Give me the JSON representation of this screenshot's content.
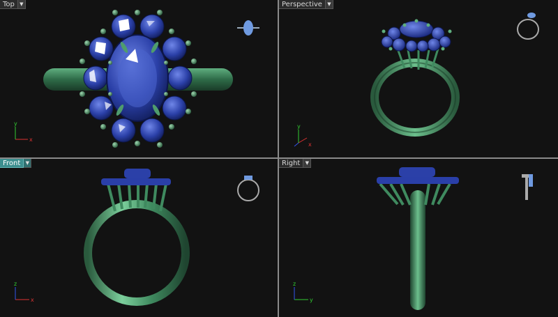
{
  "viewports": {
    "top": {
      "title": "Top"
    },
    "perspective": {
      "title": "Perspective"
    },
    "front": {
      "title": "Front"
    },
    "right": {
      "title": "Right"
    }
  },
  "axes": {
    "x": "x",
    "y": "y",
    "z": "z"
  },
  "colors": {
    "viewport_bg": "#121212",
    "metal": "#3f8a5f",
    "gem": "#2a3fa8",
    "axis_x": "#dd3333",
    "axis_y": "#33cc33",
    "axis_z": "#3355ee",
    "active_tab": "#3d8f8f"
  },
  "icons": [
    "dropdown-arrow-icon",
    "view-cube-icon",
    "axis-triad-icon"
  ]
}
